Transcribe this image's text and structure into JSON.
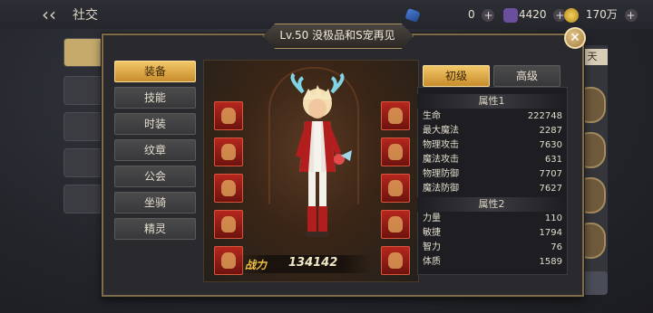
{
  "topbar": {
    "title": "社交",
    "resources": [
      {
        "icon": "feather-icon",
        "value": "0"
      },
      {
        "icon": "crystal-icon",
        "value": "4420"
      },
      {
        "icon": "coin-icon",
        "value": "170万"
      }
    ],
    "plus": "+"
  },
  "background": {
    "right_tab": "天"
  },
  "dialog": {
    "title": "Lv.50 没极品和S宠再见",
    "close": "✕",
    "categories": [
      "装备",
      "技能",
      "时装",
      "纹章",
      "公会",
      "坐骑",
      "精灵"
    ],
    "active_category": "装备",
    "power_label": "战力",
    "power_value": "134142",
    "tiers": [
      "初级",
      "高级"
    ],
    "active_tier": "初级",
    "section1": {
      "title": "属性1",
      "rows": [
        {
          "k": "生命",
          "v": "222748"
        },
        {
          "k": "最大魔法",
          "v": "2287"
        },
        {
          "k": "物理攻击",
          "v": "7630"
        },
        {
          "k": "魔法攻击",
          "v": "631"
        },
        {
          "k": "物理防御",
          "v": "7707"
        },
        {
          "k": "魔法防御",
          "v": "7627"
        }
      ]
    },
    "section2": {
      "title": "属性2",
      "rows": [
        {
          "k": "力量",
          "v": "110"
        },
        {
          "k": "敏捷",
          "v": "1794"
        },
        {
          "k": "智力",
          "v": "76"
        },
        {
          "k": "体质",
          "v": "1589"
        }
      ]
    }
  }
}
